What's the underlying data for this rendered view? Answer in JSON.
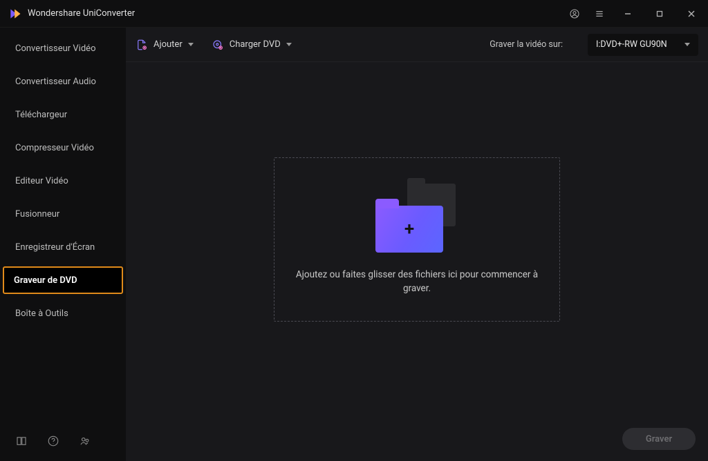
{
  "app": {
    "title": "Wondershare UniConverter"
  },
  "sidebar": {
    "items": [
      {
        "label": "Convertisseur Vidéo"
      },
      {
        "label": "Convertisseur Audio"
      },
      {
        "label": "Téléchargeur"
      },
      {
        "label": "Compresseur Vidéo"
      },
      {
        "label": "Editeur Vidéo"
      },
      {
        "label": "Fusionneur"
      },
      {
        "label": "Enregistreur d'Écran"
      },
      {
        "label": "Graveur de DVD"
      },
      {
        "label": "Boîte à Outils"
      }
    ],
    "active_index": 7
  },
  "toolbar": {
    "add_label": "Ajouter",
    "load_dvd_label": "Charger DVD",
    "burn_on_label": "Graver la vidéo sur:",
    "burn_target": "I:DVD+-RW GU90N"
  },
  "dropzone": {
    "text": "Ajoutez ou faites glisser des fichiers ici pour commencer à graver."
  },
  "actions": {
    "burn_label": "Graver"
  }
}
